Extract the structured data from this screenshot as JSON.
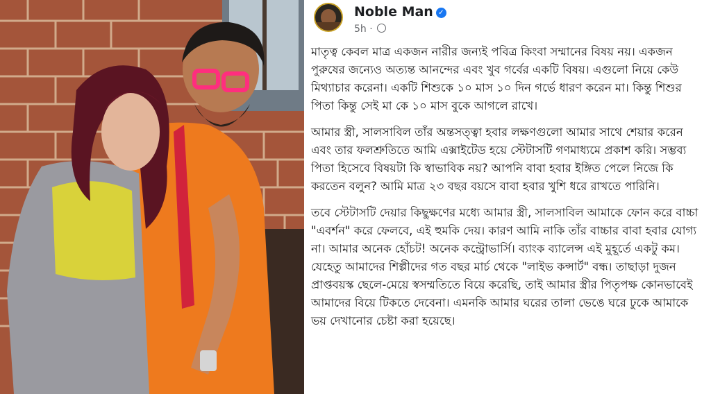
{
  "post": {
    "author": "Noble Man",
    "time": "5h",
    "separator": "·",
    "paragraphs": [
      "মাতৃত্ব কেবল মাত্র একজন নারীর জন্যই পবিত্র কিংবা সম্মানের বিষয় নয়। একজন পুরুষের জন্যেও অত্যন্ত আনন্দের এবং খুব গর্বের একটি বিষয়। এগুলো নিয়ে কেউ মিথ্যাচার করেনা। একটি শিশুকে ১০ মাস ১০ দিন গর্ভে ধারণ করেন মা। কিন্তু শিশুর পিতা কিন্তু সেই মা কে ১০ মাস বুকে আগলে রাখে।",
      "আমার স্ত্রী, সালসাবিল তাঁর অন্তসত্ত্বা হবার লক্ষণগুলো আমার সাথে শেয়ার করেন এবং তার ফলশ্রুতিতে আমি এক্সাইটেড হয়ে স্টেটাসটি গণমাধ্যমে প্রকাশ করি। সম্ভব্য পিতা হিসেবে বিষয়টা কি স্বাভাবিক নয়? আপনি বাবা হবার ইঙ্গিত পেলে নিজে কি করতেন বলুন? আমি মাত্র ২৩ বছর বয়সে বাবা হবার খুশি ধরে রাখতে পারিনি।",
      "তবে স্টেটাসটি দেয়ার কিছুক্ষণের মধ্যে আমার স্ত্রী, সালসাবিল আমাকে ফোন করে বাচ্চা \"এবর্শন\" করে ফেলবে, এই হুমকি দেয়। কারণ আমি নাকি তাঁর বাচ্চার বাবা হবার যোগ্য না। আমার অনেক হোঁচট! অনেক কন্ট্রোভার্সি। ব্যাংক ব্যালেন্স এই মুহূর্তে একটু কম। যেহেতু আমাদের শিল্পীদের গত বছর মার্চ থেকে \"লাইভ কন্সার্ট\" বন্ধ। তাছাড়া দুজন প্রাপ্তবয়স্ক ছেলে-মেয়ে স্বসম্মতিতে বিয়ে করেছি, তাই আমার স্ত্রীর পিতৃপক্ষ কোনভাবেই আমাদের বিয়ে টিকতে দেবেনা। এমনকি আমার ঘরের তালা ভেঙে ঘরে ঢুকে আমাকে ভয় দেখানোর চেষ্টা করা হয়েছে।"
    ]
  }
}
